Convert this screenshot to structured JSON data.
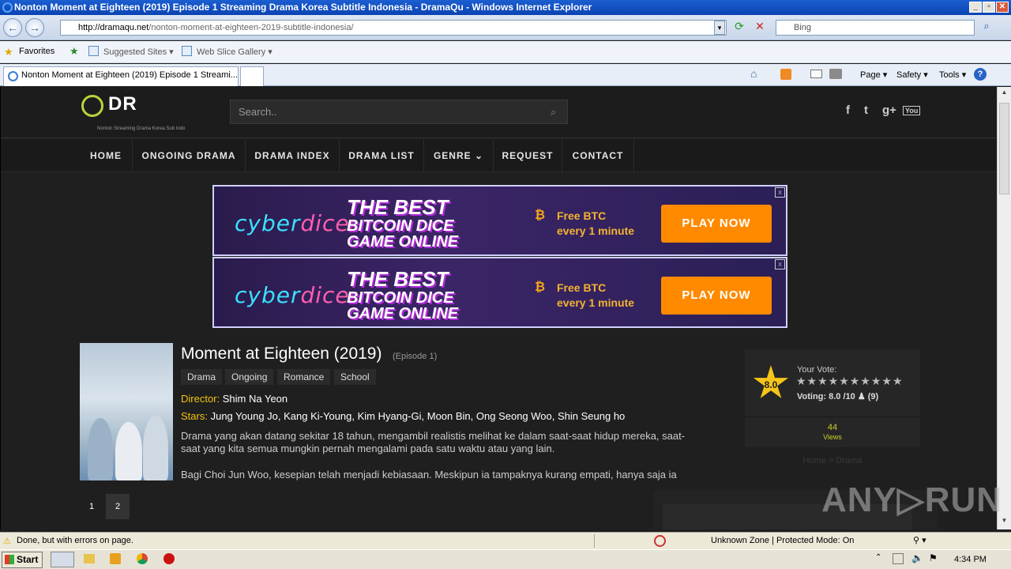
{
  "window": {
    "title": "Nonton Moment at Eighteen (2019) Episode 1 Streaming Drama Korea Subtitle Indonesia - DramaQu - Windows Internet Explorer",
    "min": "_",
    "max": "▫",
    "close": "✕"
  },
  "address": {
    "domain": "http://dramaqu.net",
    "path": "/nonton-moment-at-eighteen-2019-subtitle-indonesia/"
  },
  "ie_search_placeholder": "Bing",
  "favorites": {
    "favorites_label": "Favorites",
    "suggested": "Suggested Sites ▾",
    "webslice": "Web Slice Gallery ▾"
  },
  "tab": {
    "label": "Nonton Moment at Eighteen (2019) Episode 1 Streami..."
  },
  "commands": {
    "page": "Page ▾",
    "safety": "Safety ▾",
    "tools": "Tools ▾",
    "help": "?"
  },
  "site": {
    "logo": "DR",
    "logo_sub": "Nonton Streaming Drama Korea Sub Indo",
    "search_placeholder": "Search..",
    "social": [
      "f",
      "t",
      "g+",
      "You"
    ],
    "menu": [
      "HOME",
      "ONGOING DRAMA",
      "DRAMA INDEX",
      "DRAMA LIST",
      "GENRE  ⌄",
      "REQUEST",
      "CONTACT"
    ]
  },
  "ad": {
    "brand_a": "cyber",
    "brand_b": "dice",
    "line1": "THE BEST",
    "line2": "BITCOIN DICE",
    "line3": "GAME ONLINE",
    "btc": "₿",
    "free1": "Free BTC",
    "free2": "every 1 minute",
    "cta": "PLAY NOW"
  },
  "drama": {
    "title": "Moment at Eighteen (2019)",
    "episode": "(Episode 1)",
    "tags": [
      "Drama",
      "Ongoing",
      "Romance",
      "School"
    ],
    "director_label": "Director:",
    "director": "Shim Na Yeon",
    "stars_label": "Stars:",
    "stars": "Jung Young Jo, Kang Ki-Young, Kim Hyang-Gi, Moon Bin, Ong Seong Woo, Shin Seung ho",
    "desc1_line1": "Drama yang akan datang sekitar 18 tahun, mengambil realistis melihat ke dalam saat-saat hidup mereka, saat-",
    "desc1_line2": "saat yang kita semua mungkin pernah mengalami pada satu waktu atau yang lain.",
    "desc2": "Bagi Choi Jun Woo, kesepian telah menjadi kebiasaan. Meskipun ia tampaknya kurang empati, hanya saja ia"
  },
  "vote": {
    "score": "8.0",
    "your_vote_label": "Your Vote:",
    "stars_row": "★★★★★★★★★★",
    "voting": "Voting: 8.0 /10",
    "count": "(9)",
    "views_count": "44",
    "views_label": "Views",
    "breadcrumb": "Home > Drama"
  },
  "pagination": [
    "1",
    "2"
  ],
  "status": {
    "message": "Done, but with errors on page.",
    "zone": "Unknown Zone | Protected Mode: On"
  },
  "taskbar": {
    "start": "Start",
    "time": "4:34 PM"
  },
  "watermark": "ANY▷RUN",
  "colors": {
    "accent_yellow": "#f1c40f",
    "ad_orange": "#ff8a00",
    "menu_bg": "#1a1a1a"
  }
}
